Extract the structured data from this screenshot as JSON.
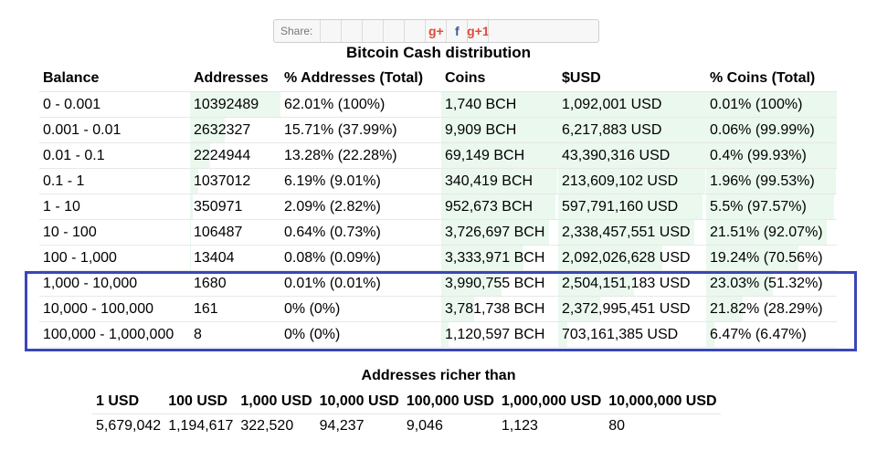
{
  "share": {
    "label": "Share:",
    "buttons": [
      {
        "name": "reddit-icon",
        "glyph": "",
        "color": "#ff4500"
      },
      {
        "name": "twitter-icon",
        "glyph": "",
        "color": "#1da1f2"
      },
      {
        "name": "vk-icon",
        "glyph": "",
        "color": "#4a76a8"
      },
      {
        "name": "weibo-icon",
        "glyph": "",
        "color": "#333333"
      },
      {
        "name": "like-icon",
        "glyph": "",
        "color": "#3b5998"
      },
      {
        "name": "google-plus-icon",
        "glyph": "g+",
        "color": "#dd4b39"
      },
      {
        "name": "facebook-icon",
        "glyph": "f",
        "color": "#3b5998"
      },
      {
        "name": "google-plus-one-icon",
        "glyph": "g+1",
        "color": "#dd4b39"
      },
      {
        "name": "blogger-icon",
        "glyph": "",
        "color": "#f57d00"
      }
    ]
  },
  "distribution": {
    "title": "Bitcoin Cash distribution",
    "headers": [
      "Balance",
      "Addresses",
      "% Addresses (Total)",
      "Coins",
      "$USD",
      "% Coins (Total)"
    ],
    "rows": [
      {
        "balance": "0 - 0.001",
        "addresses": "10392489",
        "pct_addresses": "62.01% (100%)",
        "coins": "1,740 BCH",
        "usd": "1,092,001 USD",
        "pct_coins": "0.01% (100%)",
        "addr_total_pct": 100,
        "coins_total_pct": 100
      },
      {
        "balance": "0.001 - 0.01",
        "addresses": "2632327",
        "pct_addresses": "15.71% (37.99%)",
        "coins": "9,909 BCH",
        "usd": "6,217,883 USD",
        "pct_coins": "0.06% (99.99%)",
        "addr_total_pct": 37.99,
        "coins_total_pct": 99.99
      },
      {
        "balance": "0.01 - 0.1",
        "addresses": "2224944",
        "pct_addresses": "13.28% (22.28%)",
        "coins": "69,149 BCH",
        "usd": "43,390,316 USD",
        "pct_coins": "0.4% (99.93%)",
        "addr_total_pct": 22.28,
        "coins_total_pct": 99.93
      },
      {
        "balance": "0.1 - 1",
        "addresses": "1037012",
        "pct_addresses": "6.19% (9.01%)",
        "coins": "340,419 BCH",
        "usd": "213,609,102 USD",
        "pct_coins": "1.96% (99.53%)",
        "addr_total_pct": 9.01,
        "coins_total_pct": 99.53
      },
      {
        "balance": "1 - 10",
        "addresses": "350971",
        "pct_addresses": "2.09% (2.82%)",
        "coins": "952,673 BCH",
        "usd": "597,791,160 USD",
        "pct_coins": "5.5% (97.57%)",
        "addr_total_pct": 2.82,
        "coins_total_pct": 97.57
      },
      {
        "balance": "10 - 100",
        "addresses": "106487",
        "pct_addresses": "0.64% (0.73%)",
        "coins": "3,726,697 BCH",
        "usd": "2,338,457,551 USD",
        "pct_coins": "21.51% (92.07%)",
        "addr_total_pct": 0.73,
        "coins_total_pct": 92.07
      },
      {
        "balance": "100 - 1,000",
        "addresses": "13404",
        "pct_addresses": "0.08% (0.09%)",
        "coins": "3,333,971 BCH",
        "usd": "2,092,026,628 USD",
        "pct_coins": "19.24% (70.56%)",
        "addr_total_pct": 0.09,
        "coins_total_pct": 70.56
      },
      {
        "balance": "1,000 - 10,000",
        "addresses": "1680",
        "pct_addresses": "0.01% (0.01%)",
        "coins": "3,990,755 BCH",
        "usd": "2,504,151,183 USD",
        "pct_coins": "23.03% (51.32%)",
        "addr_total_pct": 0.01,
        "coins_total_pct": 51.32
      },
      {
        "balance": "10,000 - 100,000",
        "addresses": "161",
        "pct_addresses": "0% (0%)",
        "coins": "3,781,738 BCH",
        "usd": "2,372,995,451 USD",
        "pct_coins": "21.82% (28.29%)",
        "addr_total_pct": 0,
        "coins_total_pct": 28.29
      },
      {
        "balance": "100,000 - 1,000,000",
        "addresses": "8",
        "pct_addresses": "0% (0%)",
        "coins": "1,120,597 BCH",
        "usd": "703,161,385 USD",
        "pct_coins": "6.47% (6.47%)",
        "addr_total_pct": 0,
        "coins_total_pct": 6.47
      }
    ],
    "bar_color": "#eaf8ee",
    "highlight_color": "#3a46b8"
  },
  "richer": {
    "title": "Addresses richer than",
    "headers": [
      "1 USD",
      "100 USD",
      "1,000 USD",
      "10,000 USD",
      "100,000 USD",
      "1,000,000 USD",
      "10,000,000 USD"
    ],
    "values": [
      "5,679,042",
      "1,194,617",
      "322,520",
      "94,237",
      "9,046",
      "1,123",
      "80"
    ]
  }
}
